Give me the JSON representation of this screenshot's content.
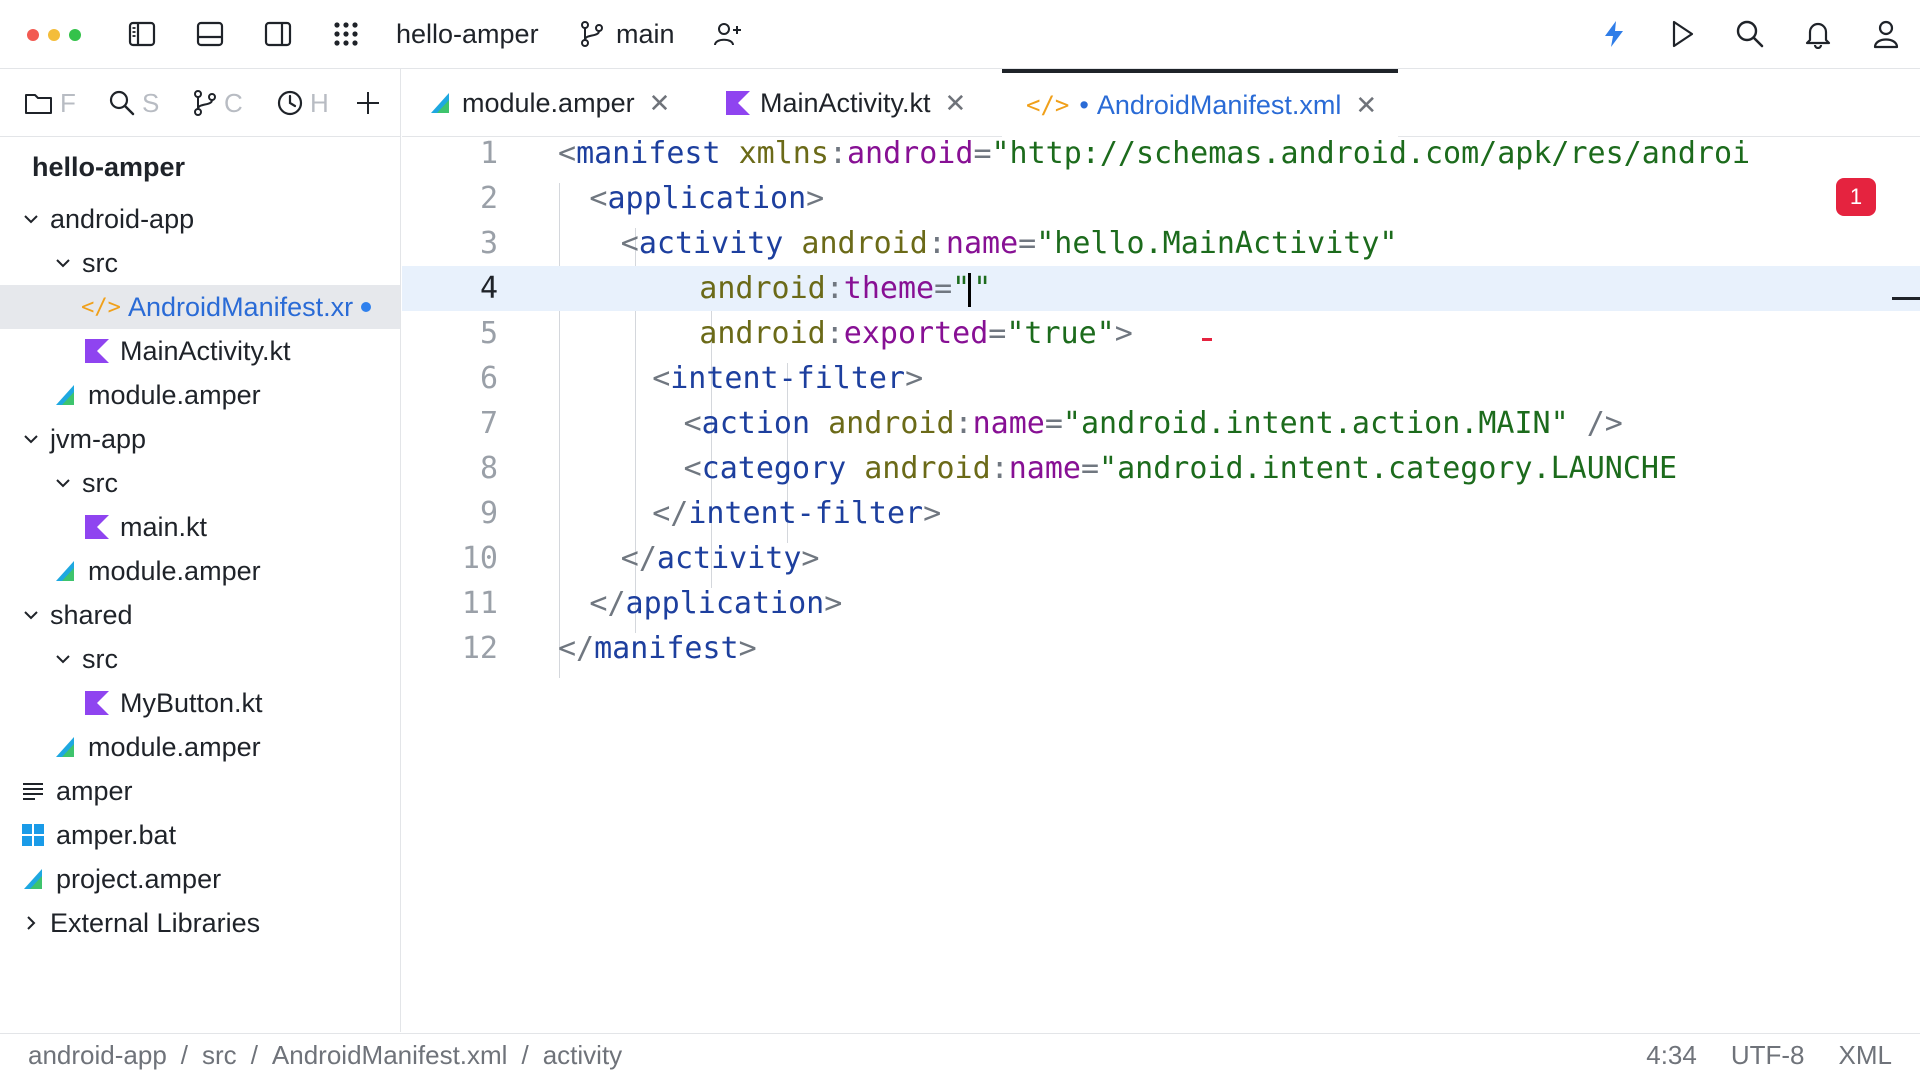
{
  "titlebar": {
    "project": "hello-amper",
    "branch": "main"
  },
  "sidebar": {
    "tabs": [
      {
        "icon": "folder-icon",
        "letter": "F"
      },
      {
        "icon": "search-icon",
        "letter": "S"
      },
      {
        "icon": "git-branch-icon",
        "letter": "C"
      },
      {
        "icon": "clock-icon",
        "letter": "H"
      },
      {
        "icon": "plus-icon",
        "letter": ""
      }
    ],
    "root": "hello-amper",
    "tree": [
      {
        "label": "android-app",
        "chevron": "down",
        "level": 0,
        "icon": ""
      },
      {
        "label": "src",
        "chevron": "down",
        "level": 1,
        "icon": ""
      },
      {
        "label": "AndroidManifest.xr",
        "chevron": "",
        "level": 2,
        "icon": "xml-icon",
        "selected": true,
        "modified": true
      },
      {
        "label": "MainActivity.kt",
        "chevron": "",
        "level": 2,
        "icon": "kotlin-icon"
      },
      {
        "label": "module.amper",
        "chevron": "",
        "level": 1,
        "icon": "amper-icon"
      },
      {
        "label": "jvm-app",
        "chevron": "down",
        "level": 0,
        "icon": ""
      },
      {
        "label": "src",
        "chevron": "down",
        "level": 1,
        "icon": ""
      },
      {
        "label": "main.kt",
        "chevron": "",
        "level": 2,
        "icon": "kotlin-icon"
      },
      {
        "label": "module.amper",
        "chevron": "",
        "level": 1,
        "icon": "amper-icon"
      },
      {
        "label": "shared",
        "chevron": "down",
        "level": 0,
        "icon": ""
      },
      {
        "label": "src",
        "chevron": "down",
        "level": 1,
        "icon": ""
      },
      {
        "label": "MyButton.kt",
        "chevron": "",
        "level": 2,
        "icon": "kotlin-icon"
      },
      {
        "label": "module.amper",
        "chevron": "",
        "level": 1,
        "icon": "amper-icon"
      },
      {
        "label": "amper",
        "chevron": "",
        "level": 0,
        "icon": "text-file-icon"
      },
      {
        "label": "amper.bat",
        "chevron": "",
        "level": 0,
        "icon": "windows-icon"
      },
      {
        "label": "project.amper",
        "chevron": "",
        "level": 0,
        "icon": "amper-icon"
      },
      {
        "label": "External Libraries",
        "chevron": "right",
        "level": 0,
        "icon": ""
      }
    ]
  },
  "editor_tabs": [
    {
      "label": "module.amper",
      "icon": "amper-icon"
    },
    {
      "label": "MainActivity.kt",
      "icon": "kotlin-icon"
    },
    {
      "label": "AndroidManifest.xml",
      "icon": "xml-icon",
      "active": true,
      "modified_dot": "•"
    }
  ],
  "editor": {
    "error_count": "1",
    "line_numbers": [
      "1",
      "2",
      "3",
      "4",
      "5",
      "6",
      "7",
      "8",
      "9",
      "10",
      "11",
      "12"
    ],
    "current_line": 4,
    "lines": {
      "l1": {
        "open": "<",
        "tag": "manifest",
        "attr": "xmlns",
        "colon": ":",
        "ns": "android",
        "eq": "=",
        "val": "\"http://schemas.android.com/apk/res/androi"
      },
      "l2": {
        "open": "<",
        "tag": "application",
        "close": ">"
      },
      "l3": {
        "open": "<",
        "tag": "activity",
        "attr": "android",
        "colon": ":",
        "ns": "name",
        "eq": "=",
        "val": "\"hello.MainActivity\""
      },
      "l4": {
        "attr": "android",
        "colon": ":",
        "ns": "theme",
        "eq": "=",
        "q1": "\"",
        "q2": "\""
      },
      "l5": {
        "attr": "android",
        "colon": ":",
        "ns": "exported",
        "eq": "=",
        "val": "\"true\"",
        "close": ">"
      },
      "l6": {
        "open": "<",
        "tag": "intent-filter",
        "close": ">"
      },
      "l7": {
        "open": "<",
        "tag": "action",
        "attr": "android",
        "colon": ":",
        "ns": "name",
        "eq": "=",
        "val": "\"android.intent.action.MAIN\"",
        "close": " />"
      },
      "l8": {
        "open": "<",
        "tag": "category",
        "attr": "android",
        "colon": ":",
        "ns": "name",
        "eq": "=",
        "val": "\"android.intent.category.LAUNCHE"
      },
      "l9": {
        "open": "</",
        "tag": "intent-filter",
        "close": ">"
      },
      "l10": {
        "open": "</",
        "tag": "activity",
        "close": ">"
      },
      "l11": {
        "open": "</",
        "tag": "application",
        "close": ">"
      },
      "l12": {
        "open": "</",
        "tag": "manifest",
        "close": ">"
      }
    }
  },
  "statusbar": {
    "breadcrumbs": [
      "android-app",
      "src",
      "AndroidManifest.xml",
      "activity"
    ],
    "separator": "/",
    "position": "4:34",
    "encoding": "UTF-8",
    "language": "XML"
  }
}
